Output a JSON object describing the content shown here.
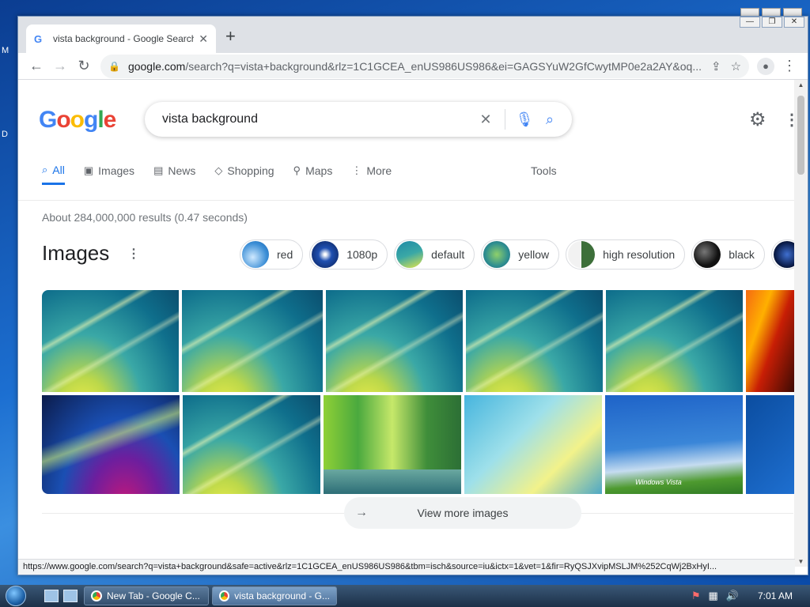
{
  "browser": {
    "tab_title": "vista background - Google Search",
    "url_host": "google.com",
    "url_rest": "/search?q=vista+background&rlz=1C1GCEA_enUS986US986&ei=GAGSYuW2GfCwytMP0e2a2AY&oq..."
  },
  "search": {
    "query": "vista background",
    "tabs": [
      {
        "label": "All",
        "icon": "search-icon"
      },
      {
        "label": "Images",
        "icon": "image-icon"
      },
      {
        "label": "News",
        "icon": "news-icon"
      },
      {
        "label": "Shopping",
        "icon": "tag-icon"
      },
      {
        "label": "Maps",
        "icon": "pin-icon"
      },
      {
        "label": "More",
        "icon": "more-vert-icon"
      }
    ],
    "tools_label": "Tools",
    "stats": "About 284,000,000 results (0.47 seconds)"
  },
  "images_section": {
    "heading": "Images",
    "chips": [
      "red",
      "1080p",
      "default",
      "yellow",
      "high resolution",
      "black"
    ],
    "view_more": "View more images",
    "thumb_watermark": "Windows Vista"
  },
  "status_url": "https://www.google.com/search?q=vista+background&safe=active&rlz=1C1GCEA_enUS986US986&tbm=isch&source=iu&ictx=1&vet=1&fir=RyQSJXvipMSLJM%252CqWj2BxHyI...",
  "taskbar": {
    "tasks": [
      "New Tab - Google C...",
      "vista background - G..."
    ],
    "clock": "7:01 AM"
  },
  "colors": {
    "accent": "#1a73e8",
    "google_blue": "#4285f4",
    "google_red": "#ea4335",
    "google_yellow": "#fbbc05",
    "google_green": "#34a853"
  }
}
